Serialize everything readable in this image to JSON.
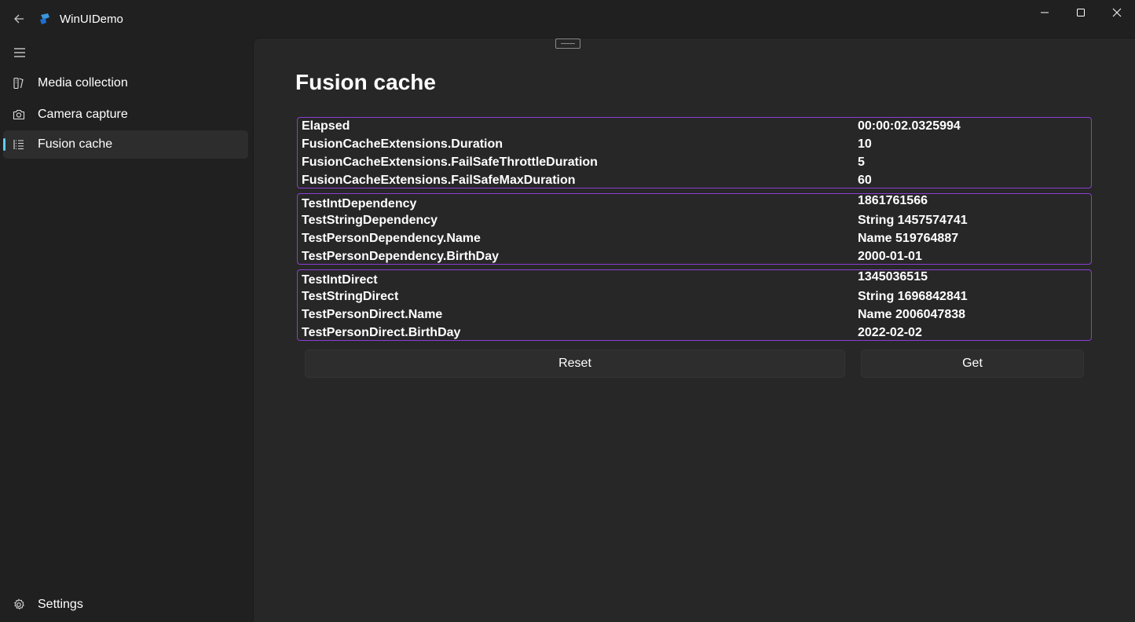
{
  "app": {
    "title": "WinUIDemo"
  },
  "nav": {
    "items": [
      {
        "label": "Media collection",
        "icon": "media-icon"
      },
      {
        "label": "Camera capture",
        "icon": "camera-icon"
      },
      {
        "label": "Fusion cache",
        "icon": "list-icon",
        "selected": true
      }
    ],
    "footer": {
      "label": "Settings",
      "icon": "gear-icon"
    }
  },
  "page": {
    "title": "Fusion cache",
    "groups": [
      {
        "rows": [
          {
            "key": "Elapsed",
            "value": "00:00:02.0325994"
          },
          {
            "key": "FusionCacheExtensions.Duration",
            "value": "10"
          },
          {
            "key": "FusionCacheExtensions.FailSafeThrottleDuration",
            "value": "5"
          },
          {
            "key": "FusionCacheExtensions.FailSafeMaxDuration",
            "value": "60"
          }
        ]
      },
      {
        "rows": [
          {
            "key": "TestIntDependency",
            "value": "1861761566"
          },
          {
            "key": "TestStringDependency",
            "value": "String 1457574741"
          },
          {
            "key": "TestPersonDependency.Name",
            "value": "Name 519764887"
          },
          {
            "key": "TestPersonDependency.BirthDay",
            "value": "2000-01-01"
          }
        ]
      },
      {
        "rows": [
          {
            "key": "TestIntDirect",
            "value": "1345036515"
          },
          {
            "key": "TestStringDirect",
            "value": "String 1696842841"
          },
          {
            "key": "TestPersonDirect.Name",
            "value": "Name 2006047838"
          },
          {
            "key": "TestPersonDirect.BirthDay",
            "value": "2022-02-02"
          }
        ]
      }
    ],
    "buttons": {
      "reset": "Reset",
      "get": "Get"
    }
  },
  "colors": {
    "accent": "#60cdff",
    "group_border": "#8a3fd1",
    "content_bg": "#272727",
    "window_bg": "#202020"
  }
}
